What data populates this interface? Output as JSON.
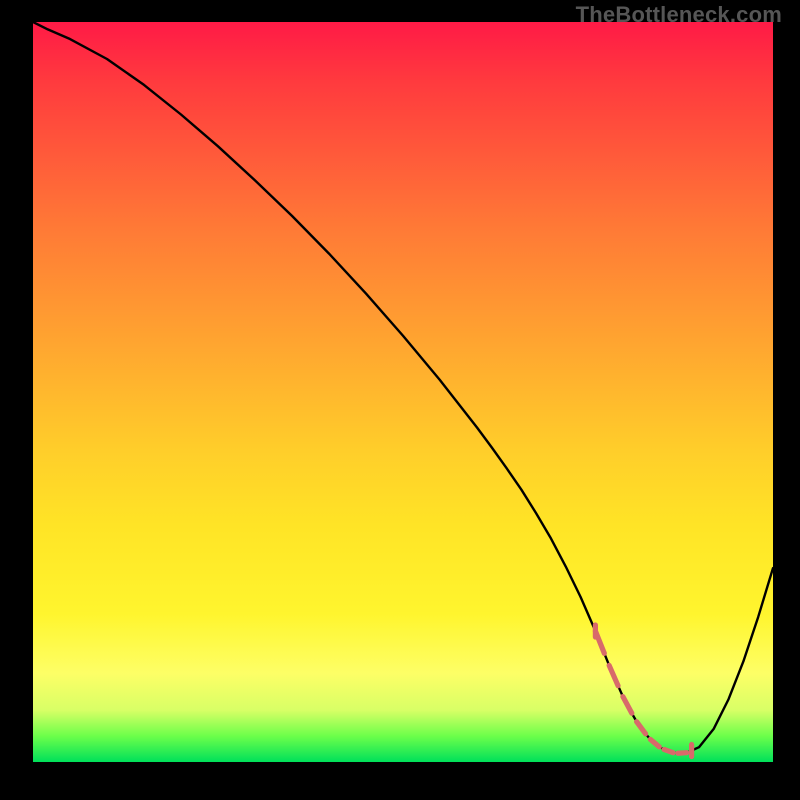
{
  "watermark": "TheBottleneck.com",
  "chart_data": {
    "type": "line",
    "title": "",
    "xlabel": "",
    "ylabel": "",
    "xlim": [
      0,
      100
    ],
    "ylim": [
      0,
      100
    ],
    "grid": false,
    "series": [
      {
        "name": "curve",
        "x": [
          0.0,
          2,
          5,
          10,
          15,
          20,
          25,
          30,
          35,
          40,
          45,
          50,
          55,
          60,
          62,
          64,
          66,
          68,
          70,
          72,
          74,
          76,
          78,
          80,
          82,
          84,
          86,
          88,
          90,
          92,
          94,
          96,
          98,
          100
        ],
        "values": [
          100,
          99,
          97.7,
          95,
          91.5,
          87.5,
          83.2,
          78.6,
          73.8,
          68.7,
          63.3,
          57.6,
          51.6,
          45.2,
          42.5,
          39.7,
          36.8,
          33.6,
          30.2,
          26.4,
          22.3,
          17.7,
          12.7,
          8.2,
          4.7,
          2.4,
          1.3,
          1.1,
          2.0,
          4.5,
          8.5,
          13.6,
          19.6,
          26.2
        ]
      }
    ],
    "annotations": [
      {
        "name": "highlight-segment",
        "x_range": [
          76,
          89
        ],
        "note": "flat minimum region highlighted with coral markers and line"
      }
    ],
    "colors": {
      "gradient_top": "#ff1a46",
      "gradient_mid": "#ffce2a",
      "gradient_bottom": "#00e05a",
      "curve": "#000000",
      "highlight": "#d86a6a"
    }
  }
}
